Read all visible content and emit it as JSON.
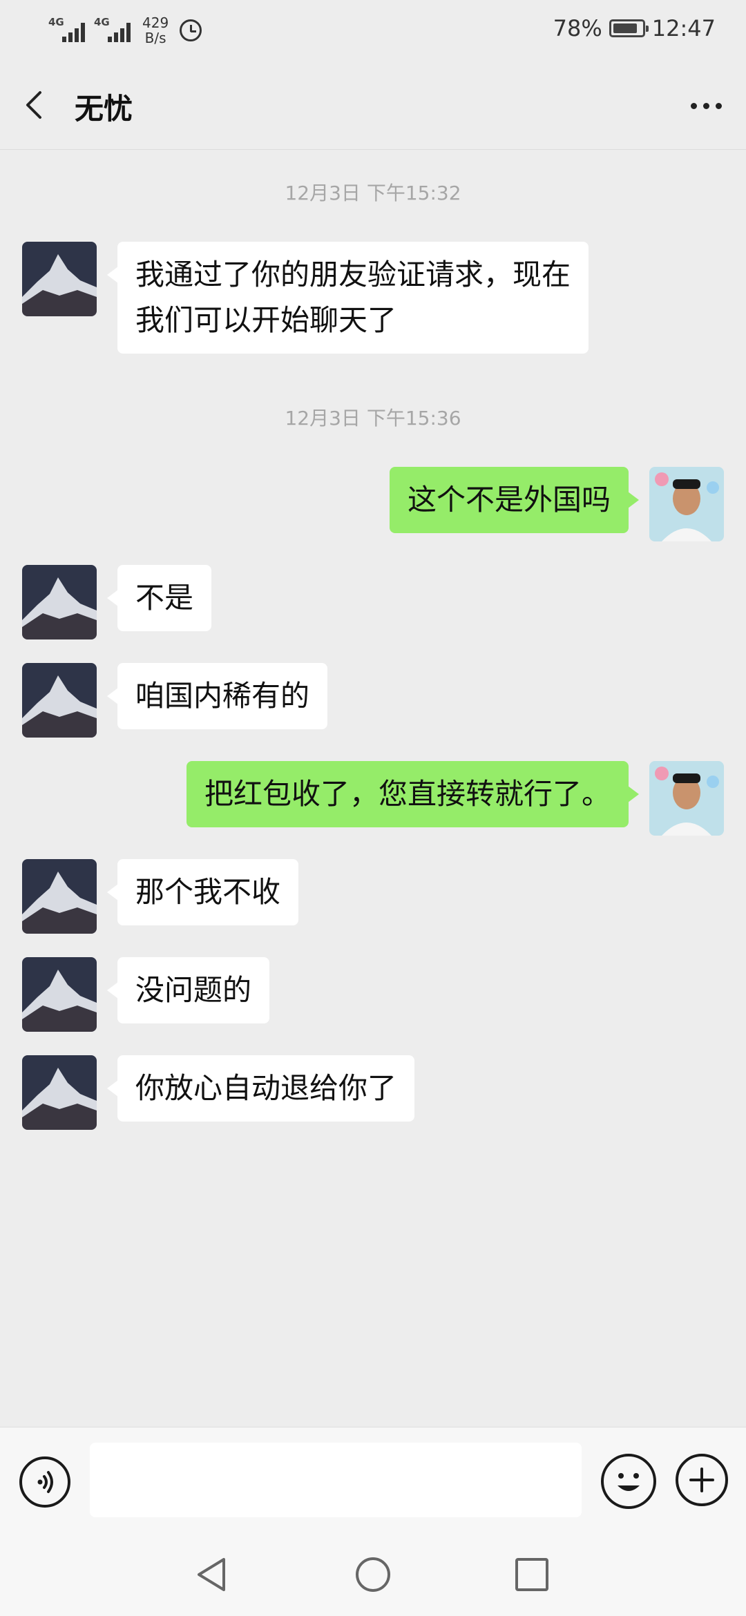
{
  "status_bar": {
    "signal1_label": "4G",
    "signal2_label": "4G",
    "speed_value": "429",
    "speed_unit": "B/s",
    "battery_percent": "78%",
    "time": "12:47"
  },
  "header": {
    "title": "无忧",
    "back_icon": "chevron-left-icon",
    "more_icon": "more-dots-icon"
  },
  "messages": [
    {
      "type": "timestamp",
      "text": "12月3日 下午15:32"
    },
    {
      "type": "message",
      "side": "left",
      "lines": [
        "我通过了你的朋友验证请求，现在",
        "我们可以开始聊天了"
      ]
    },
    {
      "type": "timestamp",
      "text": "12月3日 下午15:36"
    },
    {
      "type": "message",
      "side": "right",
      "lines": [
        "这个不是外国吗"
      ]
    },
    {
      "type": "message",
      "side": "left",
      "lines": [
        "不是"
      ]
    },
    {
      "type": "message",
      "side": "left",
      "lines": [
        "咱国内稀有的"
      ]
    },
    {
      "type": "message",
      "side": "right",
      "lines": [
        "把红包收了，您直接转就行了。"
      ]
    },
    {
      "type": "message",
      "side": "left",
      "lines": [
        "那个我不收"
      ]
    },
    {
      "type": "message",
      "side": "left",
      "lines": [
        "没问题的"
      ]
    },
    {
      "type": "message",
      "side": "left",
      "lines": [
        "你放心自动退给你了"
      ]
    }
  ],
  "input_bar": {
    "input_value": "",
    "input_placeholder": "",
    "voice_icon": "voice-icon",
    "emoji_icon": "emoji-icon",
    "plus_icon": "plus-icon"
  },
  "nav_bar": {
    "back_icon": "nav-back-icon",
    "home_icon": "nav-home-icon",
    "recents_icon": "nav-recents-icon"
  },
  "colors": {
    "background": "#ededed",
    "sent_bubble": "#95ec69",
    "received_bubble": "#ffffff",
    "timestamp": "#a6a6a6"
  }
}
